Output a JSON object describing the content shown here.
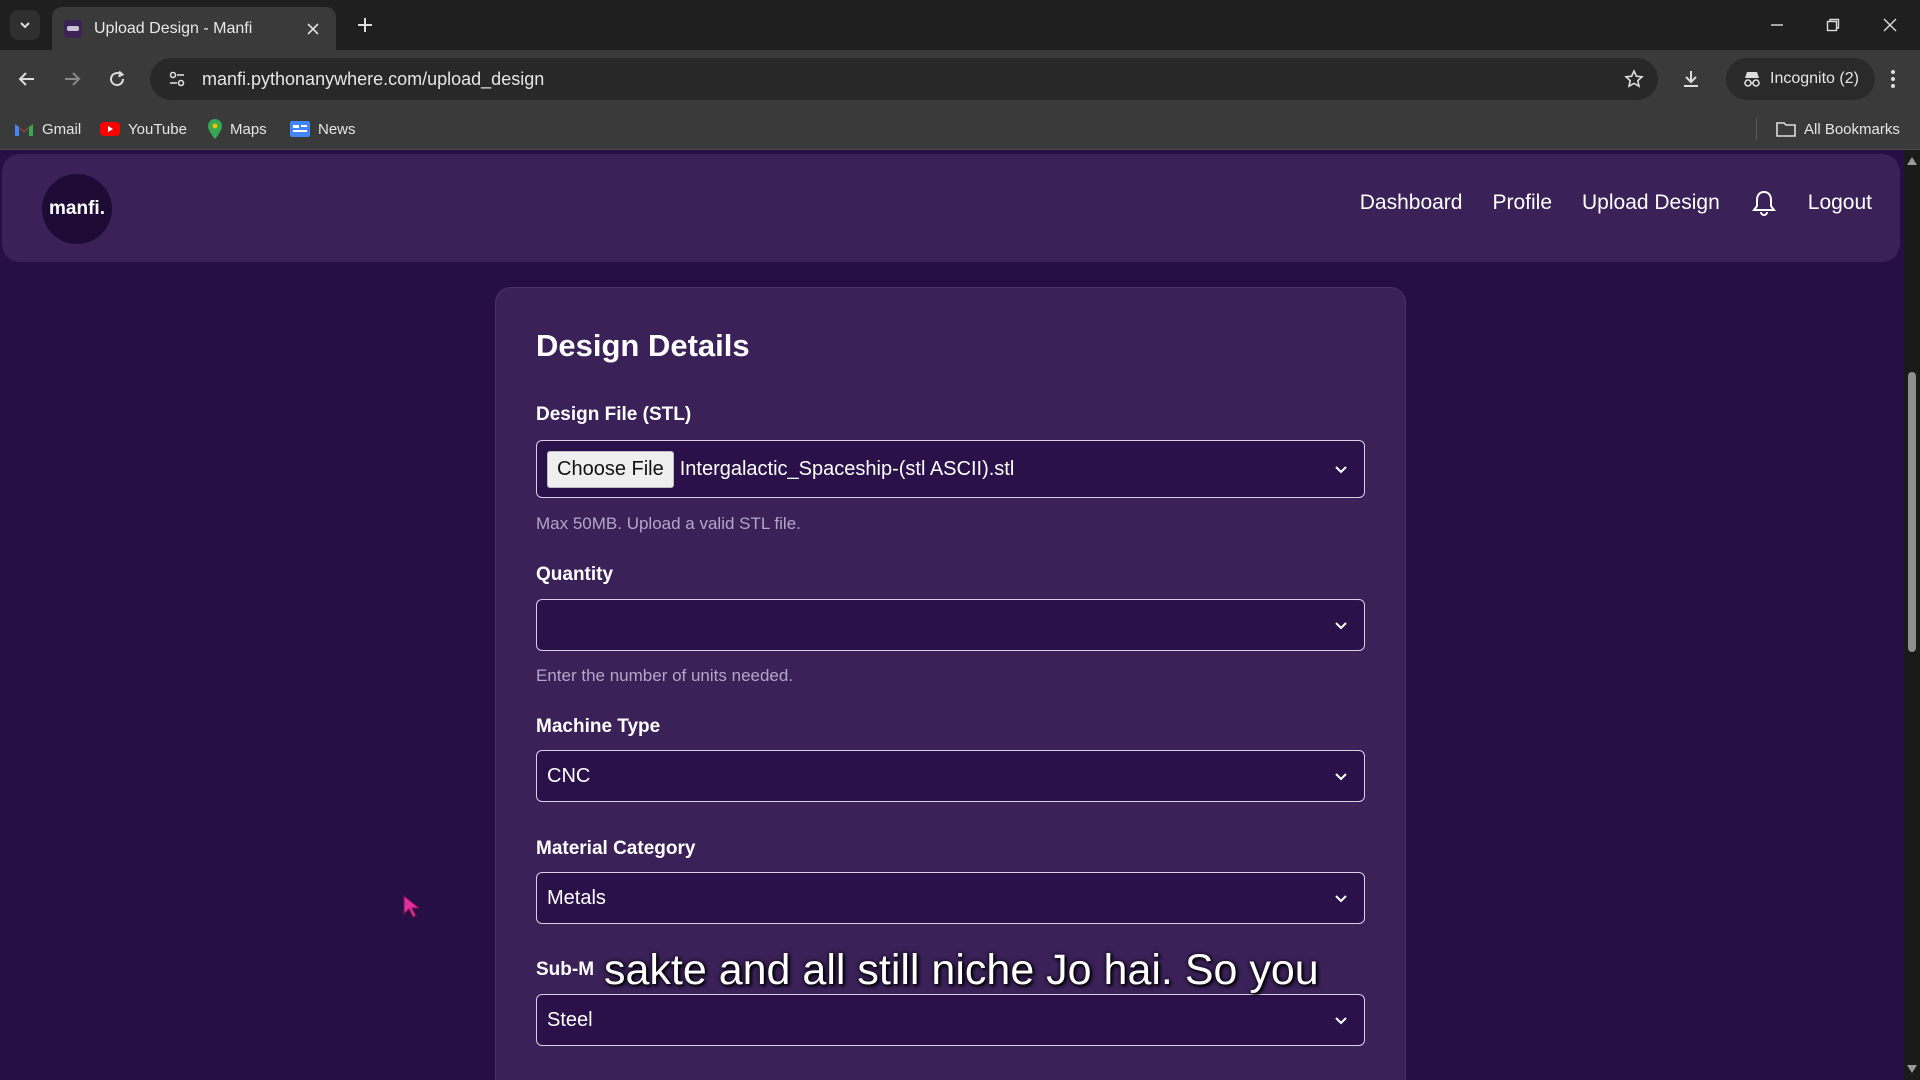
{
  "browser": {
    "tab_title": "Upload Design - Manfi",
    "url": "manfi.pythonanywhere.com/upload_design",
    "incognito_label": "Incognito (2)",
    "bookmarks": [
      {
        "label": "Gmail",
        "icon": "gmail-icon"
      },
      {
        "label": "YouTube",
        "icon": "youtube-icon"
      },
      {
        "label": "Maps",
        "icon": "maps-icon"
      },
      {
        "label": "News",
        "icon": "news-icon"
      }
    ],
    "all_bookmarks_label": "All Bookmarks"
  },
  "site": {
    "logo_text": "manfi.",
    "nav": {
      "dashboard": "Dashboard",
      "profile": "Profile",
      "upload_design": "Upload Design",
      "logout": "Logout"
    }
  },
  "form": {
    "title": "Design Details",
    "design_file": {
      "label": "Design File (STL)",
      "button_label": "Choose File",
      "file_name": "Intergalactic_Spaceship-(stl ASCII).stl",
      "hint": "Max 50MB. Upload a valid STL file."
    },
    "quantity": {
      "label": "Quantity",
      "value": "",
      "hint": "Enter the number of units needed."
    },
    "machine_type": {
      "label": "Machine Type",
      "value": "CNC"
    },
    "material_category": {
      "label": "Material Category",
      "value": "Metals"
    },
    "sub_material": {
      "label": "Sub-M",
      "value": "Steel"
    }
  },
  "caption": "sakte and all still niche Jo hai. So you",
  "colors": {
    "page_bg": "#250f45",
    "card_bg": "#3a2158",
    "field_bg": "#2a1149",
    "cursor": "#e0309a"
  }
}
